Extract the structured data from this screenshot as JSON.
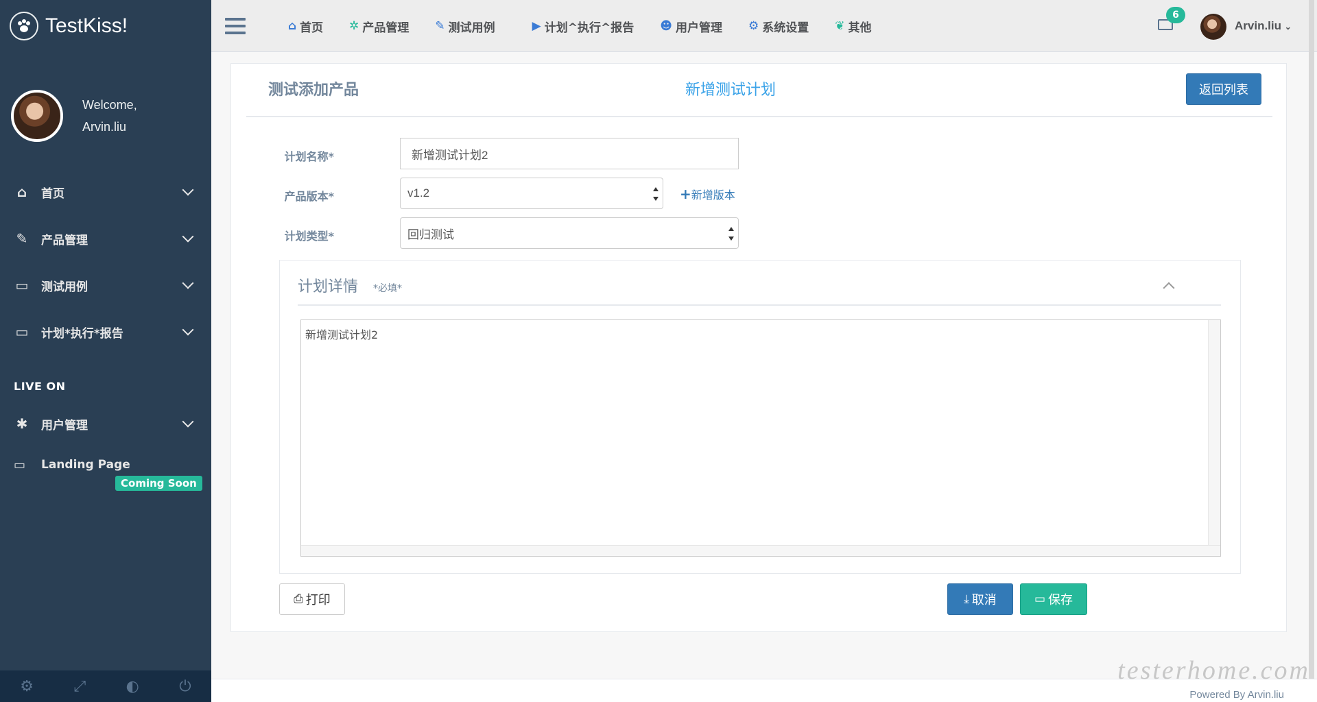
{
  "brand": {
    "title": "TestKiss!"
  },
  "profile": {
    "welcome": "Welcome,",
    "name": "Arvin.liu"
  },
  "sidebar": {
    "items": [
      {
        "label": "首页",
        "icon": "home-icon"
      },
      {
        "label": "产品管理",
        "icon": "edit-icon"
      },
      {
        "label": "测试用例",
        "icon": "desktop-icon"
      },
      {
        "label": "计划*执行*报告",
        "icon": "desktop-icon"
      }
    ],
    "section_title": "LIVE ON",
    "live_items": [
      {
        "label": "用户管理",
        "icon": "bug-icon"
      }
    ],
    "landing": {
      "label": "Landing Page",
      "badge": "Coming Soon"
    }
  },
  "topnav": {
    "items": [
      {
        "label": "首页",
        "icon": "home-icon"
      },
      {
        "label": "产品管理",
        "icon": "gear-wheel-icon"
      },
      {
        "label": "测试用例",
        "icon": "edit-icon"
      },
      {
        "label": "计划^执行^报告",
        "icon": "play-circle-icon"
      },
      {
        "label": "用户管理",
        "icon": "users-icon"
      },
      {
        "label": "系统设置",
        "icon": "cogs-icon"
      },
      {
        "label": "其他",
        "icon": "leaf-icon"
      }
    ],
    "mail_count": "6",
    "user_name": "Arvin.liu"
  },
  "panel": {
    "title": "测试添加产品",
    "center_title": "新增测试计划",
    "back_button": "返回列表"
  },
  "form": {
    "plan_name_label": "计划名称*",
    "plan_name_value": "新增测试计划2",
    "version_label": "产品版本*",
    "version_value": "v1.2",
    "add_version": "新增版本",
    "type_label": "计划类型*",
    "type_value": "回归测试"
  },
  "detail": {
    "title": "计划详情",
    "required": "*必填*",
    "content": "新增测试计划2"
  },
  "actions": {
    "print": "打印",
    "cancel": "取消",
    "save": "保存"
  },
  "footer": {
    "text": "Powered By Arvin.liu",
    "watermark": "testerhome.com"
  },
  "colors": {
    "sidebar": "#2a3f54",
    "accent_blue": "#337ab7",
    "accent_green": "#26b99a",
    "title_blue": "#3ba3e8"
  }
}
